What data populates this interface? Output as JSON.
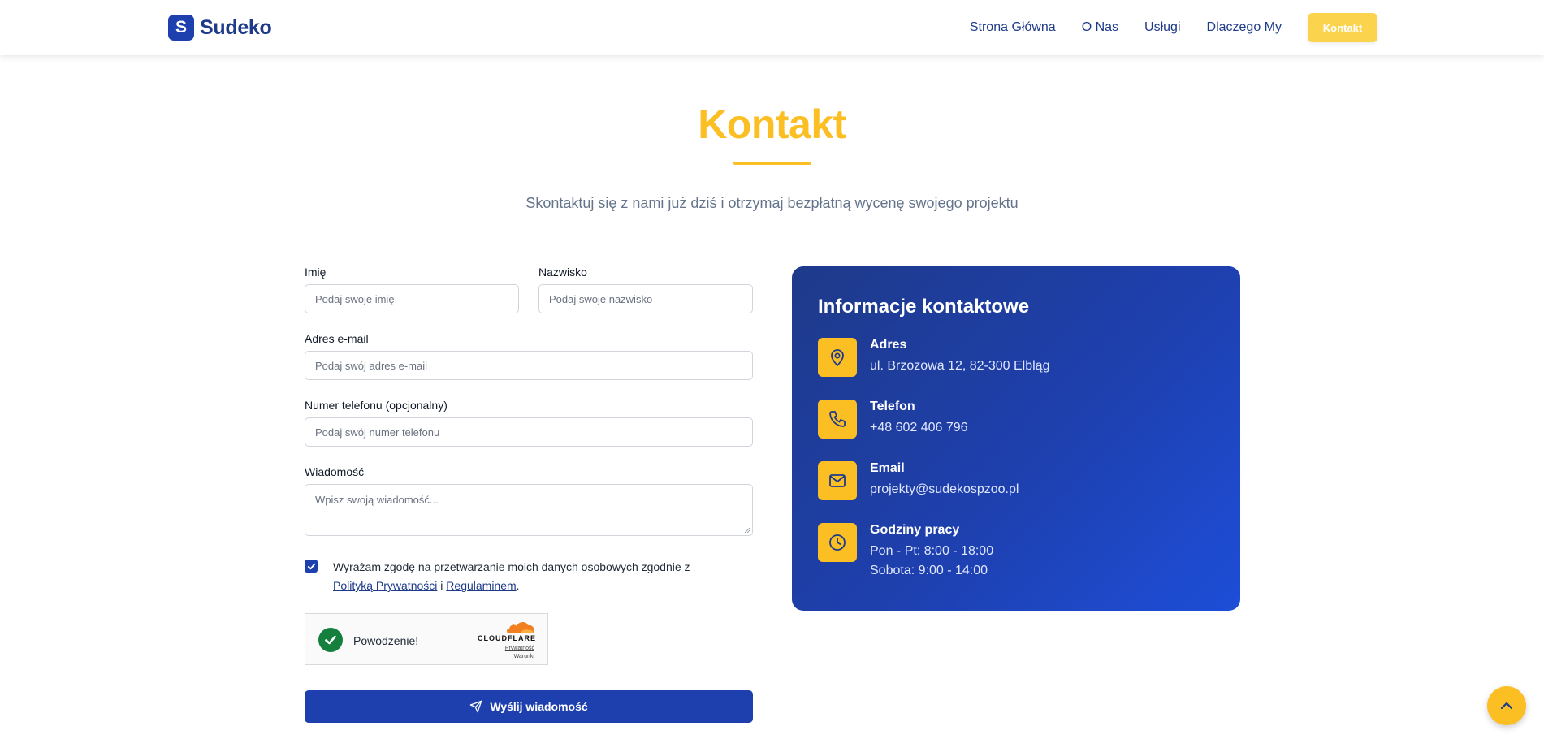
{
  "brand": {
    "initial": "S",
    "name": "Sudeko"
  },
  "nav": {
    "links": [
      "Strona Główna",
      "O Nas",
      "Usługi",
      "Dlaczego My"
    ],
    "cta": "Kontakt"
  },
  "hero": {
    "title": "Kontakt",
    "subtitle": "Skontaktuj się z nami już dziś i otrzymaj bezpłatną wycenę swojego projektu"
  },
  "form": {
    "first_name": {
      "label": "Imię",
      "placeholder": "Podaj swoje imię"
    },
    "last_name": {
      "label": "Nazwisko",
      "placeholder": "Podaj swoje nazwisko"
    },
    "email": {
      "label": "Adres e-mail",
      "placeholder": "Podaj swój adres e-mail"
    },
    "phone": {
      "label": "Numer telefonu (opcjonalny)",
      "placeholder": "Podaj swój numer telefonu"
    },
    "message": {
      "label": "Wiadomość",
      "placeholder": "Wpisz swoją wiadomość..."
    },
    "consent": {
      "checked": true,
      "text_before": "Wyrażam zgodę na przetwarzanie moich danych osobowych zgodnie z",
      "privacy_link": "Polityką Prywatności",
      "joiner": "i",
      "terms_link": "Regulaminem",
      "end": "."
    },
    "captcha": {
      "status": "Powodzenie!",
      "brand": "CLOUDFLARE",
      "privacy": "Prywatność",
      "terms": "Warunki"
    },
    "submit_label": "Wyślij wiadomość"
  },
  "contact_info": {
    "title": "Informacje kontaktowe",
    "items": [
      {
        "icon": "map-pin-icon",
        "label": "Adres",
        "value": "ul. Brzozowa 12, 82-300 Elbląg"
      },
      {
        "icon": "phone-icon",
        "label": "Telefon",
        "value": "+48 602 406 796"
      },
      {
        "icon": "mail-icon",
        "label": "Email",
        "value": "projekty@sudekospzoo.pl"
      },
      {
        "icon": "clock-icon",
        "label": "Godziny pracy",
        "value": "Pon - Pt: 8:00 - 18:00",
        "value2": "Sobota: 9:00 - 14:00"
      }
    ]
  },
  "colors": {
    "primary": "#1e40af",
    "accent": "#fbbf24",
    "nav_text": "#1e3a8a"
  }
}
